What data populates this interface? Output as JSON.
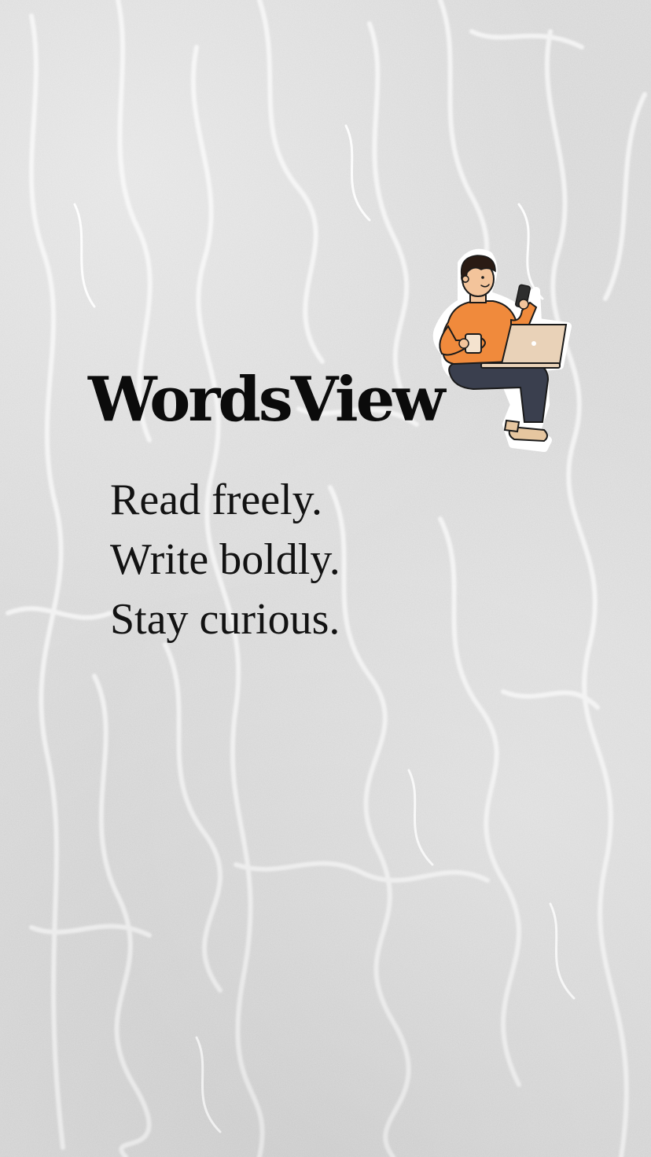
{
  "brand": {
    "name": "WordsView"
  },
  "tagline": {
    "lines": [
      "Read freely.",
      "Write boldly.",
      "Stay curious."
    ]
  },
  "illustration": {
    "icon": "person-with-laptop-and-phone-icon",
    "colors": {
      "shirt": "#F08A3C",
      "pants": "#3A3F4E",
      "skin": "#F3C49B",
      "hair": "#2A1B14",
      "laptop": "#E9D2B8",
      "shoes": "#E6C6A0"
    }
  },
  "theme": {
    "background": "#D6D6D6",
    "text": "#0B0B0B"
  }
}
